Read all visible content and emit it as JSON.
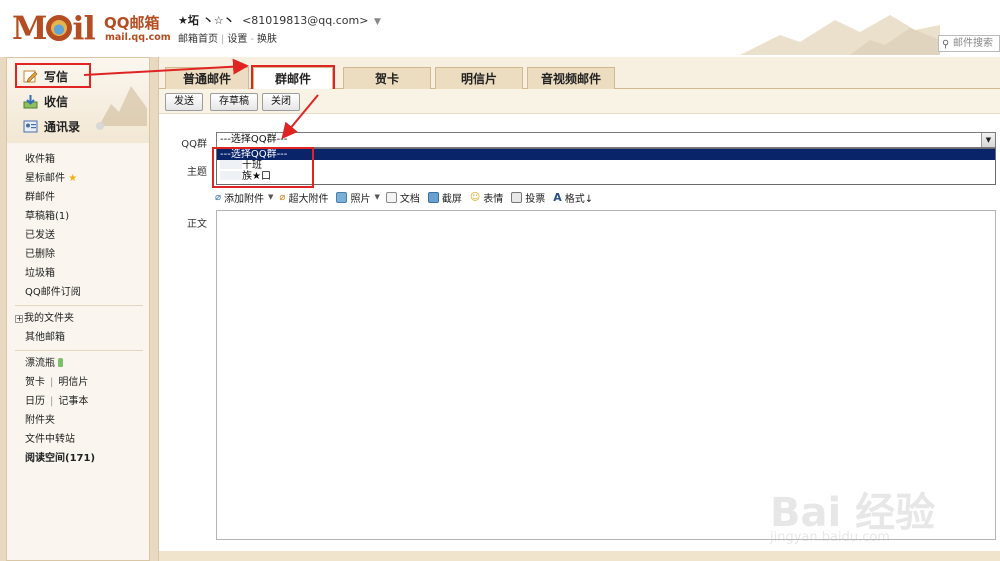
{
  "header": {
    "logo_text": "MOil",
    "logo_brand": "QQ邮箱",
    "logo_url": "mail.qq.com",
    "user_name": "★坧 丶☆丶",
    "user_email": "<81019813@qq.com>",
    "links": [
      "邮箱首页",
      "设置",
      "换肤"
    ],
    "search_placeholder": "邮件搜索"
  },
  "sidebar": {
    "compose": "写信",
    "inbox": "收信",
    "contacts": "通讯录",
    "mail_items": [
      "收件箱",
      "星标邮件",
      "群邮件",
      "草稿箱(1)",
      "已发送",
      "已删除",
      "垃圾箱",
      "QQ邮件订阅"
    ],
    "folders": [
      "我的文件夹",
      "其他邮箱"
    ],
    "apps": {
      "drift_bottle": "漂流瓶",
      "greeting": "贺卡",
      "postcard": "明信片",
      "calendar": "日历",
      "notes": "记事本",
      "attachments": "附件夹",
      "file_transfer": "文件中转站",
      "reading": "阅读空间(171)"
    }
  },
  "tabs": [
    "普通邮件",
    "群邮件",
    "贺卡",
    "明信片",
    "音视频邮件"
  ],
  "active_tab": "群邮件",
  "toolbar": {
    "send": "发送",
    "save_draft": "存草稿",
    "close": "关闭"
  },
  "form": {
    "qq_group_label": "QQ群",
    "qq_group_selected": "---选择QQ群---",
    "qq_group_options": [
      "---选择QQ群---",
      "十班",
      "族★口"
    ],
    "subject_label": "主题",
    "body_label": "正文"
  },
  "attach_bar": {
    "add_attachment": "添加附件",
    "large_attachment": "超大附件",
    "photo": "照片",
    "document": "文档",
    "screenshot": "截屏",
    "emoji": "表情",
    "vote": "投票",
    "format": "格式↓"
  },
  "watermark": {
    "text": "Bai 经验",
    "url": "jingyan.baidu.com"
  },
  "colors": {
    "brand": "#b54d22",
    "highlight": "#e02424",
    "sidebar_bg": "#faf6ef",
    "tab_bg": "#ecdcc0",
    "selected_option": "#0a246a"
  }
}
